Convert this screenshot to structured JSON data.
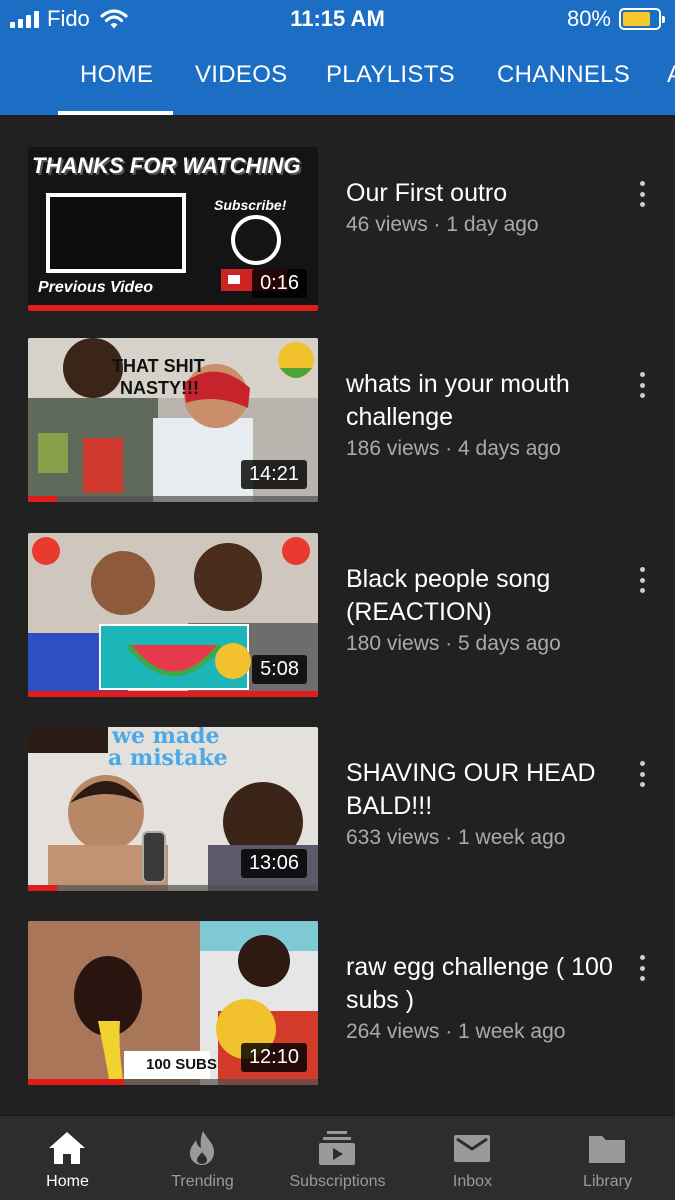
{
  "status_bar": {
    "carrier": "Fido",
    "time": "11:15 AM",
    "battery": "80%"
  },
  "tabs": [
    {
      "label": "HOME",
      "active": true
    },
    {
      "label": "VIDEOS"
    },
    {
      "label": "PLAYLISTS"
    },
    {
      "label": "CHANNELS"
    },
    {
      "label": "A"
    }
  ],
  "videos": [
    {
      "title": "Our First outro",
      "meta": "46 views · 1 day ago",
      "duration": "0:16",
      "thumb_text": [
        "THANKS FOR WATCHING",
        "Subscribe!",
        "Previous Video"
      ]
    },
    {
      "title": "whats in your mouth challenge",
      "meta": "186 views · 4 days ago",
      "duration": "14:21",
      "thumb_text": [
        "THAT SHIT",
        "NASTY!!!"
      ]
    },
    {
      "title": "Black people song (REACTION)",
      "meta": "180 views · 5 days ago",
      "duration": "5:08"
    },
    {
      "title": "SHAVING OUR HEAD BALD!!!",
      "meta": "633 views · 1 week ago",
      "duration": "13:06",
      "thumb_text": [
        "we made",
        "a mistake"
      ]
    },
    {
      "title": "raw egg challenge ( 100 subs )",
      "meta": "264 views · 1 week ago",
      "duration": "12:10",
      "thumb_text": [
        "100 SUBS"
      ]
    }
  ],
  "bottom_nav": [
    {
      "label": "Home",
      "icon": "home-icon",
      "active": true
    },
    {
      "label": "Trending",
      "icon": "flame-icon"
    },
    {
      "label": "Subscriptions",
      "icon": "subscriptions-icon"
    },
    {
      "label": "Inbox",
      "icon": "mail-icon"
    },
    {
      "label": "Library",
      "icon": "folder-icon"
    }
  ],
  "colors": {
    "header": "#1c6dc4",
    "background": "#212121",
    "progress": "#e21b1b",
    "battery": "#f7c82a"
  }
}
